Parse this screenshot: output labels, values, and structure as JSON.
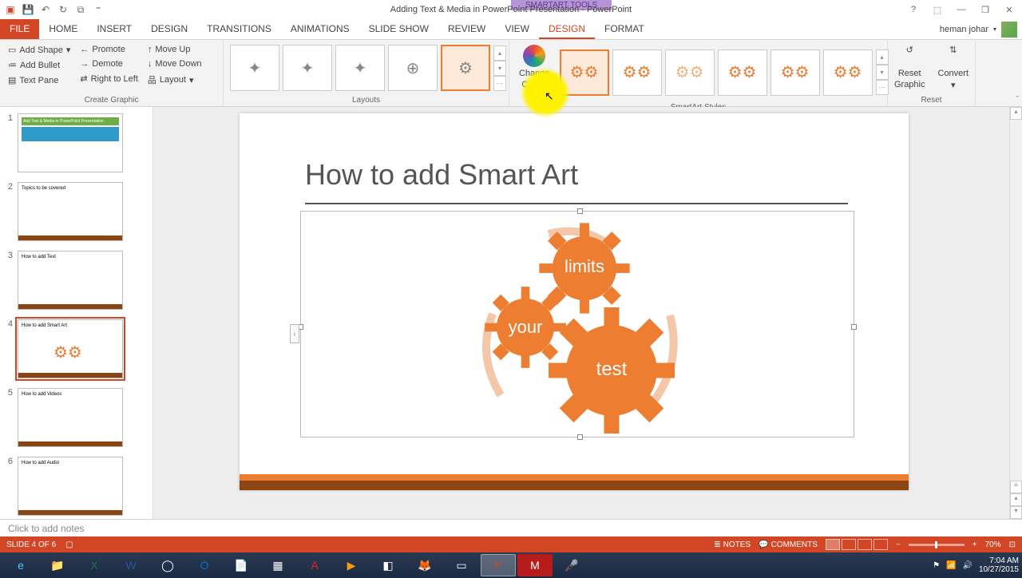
{
  "app": {
    "title": "Adding Text & Media in  PowerPoint Presentation - PowerPoint",
    "contextual_tab": "SMARTART TOOLS"
  },
  "qat": {
    "items": [
      "powerpoint-icon",
      "save-icon",
      "undo-icon",
      "redo-icon",
      "start-from-beginning-icon",
      "customize-icon"
    ]
  },
  "window_controls": {
    "help": "?",
    "full": "⬚",
    "min": "—",
    "restore": "❐",
    "close": "✕"
  },
  "tabs": {
    "items": [
      "FILE",
      "HOME",
      "INSERT",
      "DESIGN",
      "TRANSITIONS",
      "ANIMATIONS",
      "SLIDE SHOW",
      "REVIEW",
      "VIEW",
      "DESIGN",
      "FORMAT"
    ],
    "active_index": 9
  },
  "user": {
    "name": "heman johar"
  },
  "ribbon": {
    "create_graphic": {
      "label": "Create Graphic",
      "add_shape": "Add Shape",
      "add_bullet": "Add Bullet",
      "text_pane": "Text Pane",
      "promote": "Promote",
      "demote": "Demote",
      "right_to_left": "Right to Left",
      "move_up": "Move Up",
      "move_down": "Move Down",
      "layout": "Layout"
    },
    "layouts": {
      "label": "Layouts"
    },
    "change_colors": {
      "line1": "Change",
      "line2": "Colors"
    },
    "styles": {
      "label": "SmartArt Styles"
    },
    "reset": {
      "label": "Reset",
      "reset_graphic_l1": "Reset",
      "reset_graphic_l2": "Graphic",
      "convert": "Convert"
    }
  },
  "slides_panel": {
    "slides": [
      {
        "num": "1",
        "title": "Add Text & Media in PowerPoint Presentation"
      },
      {
        "num": "2",
        "title": "Topics to be covered"
      },
      {
        "num": "3",
        "title": "How to add Text"
      },
      {
        "num": "4",
        "title": "How to add Smart Art"
      },
      {
        "num": "5",
        "title": "How to add Videos"
      },
      {
        "num": "6",
        "title": "How to add Audio"
      }
    ],
    "active_index": 3
  },
  "slide": {
    "title": "How to add Smart Art",
    "gears": {
      "g1": "limits",
      "g2": "your",
      "g3": "test"
    }
  },
  "notes": {
    "placeholder": "Click to add notes"
  },
  "status": {
    "slide_info": "SLIDE 4 OF 6",
    "notes": "NOTES",
    "comments": "COMMENTS",
    "zoom": "70%"
  },
  "taskbar": {
    "time": "7:04 AM",
    "date": "10/27/2015"
  }
}
